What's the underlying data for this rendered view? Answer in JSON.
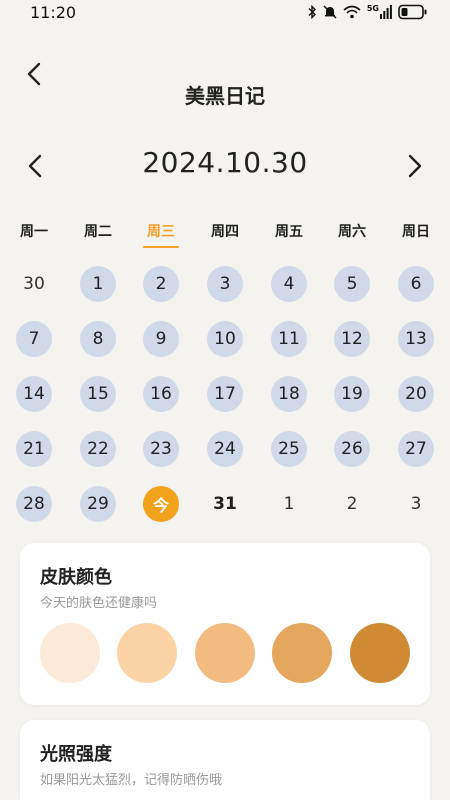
{
  "status_bar": {
    "time": "11:20",
    "icons": [
      "bluetooth-icon",
      "mute-bell-icon",
      "wifi-icon",
      "signal-5g-icon",
      "battery-icon"
    ],
    "network_label": "5G"
  },
  "header": {
    "back_icon": "chevron-left-icon",
    "title": "美黑日记"
  },
  "date_nav": {
    "prev_icon": "chevron-left-icon",
    "current_date": "2024.10.30",
    "next_icon": "chevron-right-icon"
  },
  "weekdays": [
    {
      "label": "周一",
      "active": false
    },
    {
      "label": "周二",
      "active": false
    },
    {
      "label": "周三",
      "active": true
    },
    {
      "label": "周四",
      "active": false
    },
    {
      "label": "周五",
      "active": false
    },
    {
      "label": "周六",
      "active": false
    },
    {
      "label": "周日",
      "active": false
    }
  ],
  "calendar": {
    "weeks": [
      [
        {
          "label": "30",
          "state": "plain"
        },
        {
          "label": "1",
          "state": "recorded"
        },
        {
          "label": "2",
          "state": "recorded"
        },
        {
          "label": "3",
          "state": "recorded"
        },
        {
          "label": "4",
          "state": "recorded"
        },
        {
          "label": "5",
          "state": "recorded"
        },
        {
          "label": "6",
          "state": "recorded"
        }
      ],
      [
        {
          "label": "7",
          "state": "recorded"
        },
        {
          "label": "8",
          "state": "recorded"
        },
        {
          "label": "9",
          "state": "recorded"
        },
        {
          "label": "10",
          "state": "recorded"
        },
        {
          "label": "11",
          "state": "recorded"
        },
        {
          "label": "12",
          "state": "recorded"
        },
        {
          "label": "13",
          "state": "recorded"
        }
      ],
      [
        {
          "label": "14",
          "state": "recorded"
        },
        {
          "label": "15",
          "state": "recorded"
        },
        {
          "label": "16",
          "state": "recorded"
        },
        {
          "label": "17",
          "state": "recorded"
        },
        {
          "label": "18",
          "state": "recorded"
        },
        {
          "label": "19",
          "state": "recorded"
        },
        {
          "label": "20",
          "state": "recorded"
        }
      ],
      [
        {
          "label": "21",
          "state": "recorded"
        },
        {
          "label": "22",
          "state": "recorded"
        },
        {
          "label": "23",
          "state": "recorded"
        },
        {
          "label": "24",
          "state": "recorded"
        },
        {
          "label": "25",
          "state": "recorded"
        },
        {
          "label": "26",
          "state": "recorded"
        },
        {
          "label": "27",
          "state": "recorded"
        }
      ],
      [
        {
          "label": "28",
          "state": "recorded"
        },
        {
          "label": "29",
          "state": "recorded"
        },
        {
          "label": "今",
          "state": "today"
        },
        {
          "label": "31",
          "state": "bold"
        },
        {
          "label": "1",
          "state": "plain"
        },
        {
          "label": "2",
          "state": "plain"
        },
        {
          "label": "3",
          "state": "plain"
        }
      ]
    ]
  },
  "skin_color_card": {
    "title": "皮肤颜色",
    "subtitle": "今天的肤色还健康吗",
    "swatches": [
      "#fde9d8",
      "#fbd3a5",
      "#f3bb80",
      "#e4a75d",
      "#cf8a33"
    ]
  },
  "light_card": {
    "title": "光照强度",
    "subtitle": "如果阳光太猛烈，记得防晒伤哦"
  },
  "colors": {
    "background": "#f4f3ef",
    "accent": "#f3a21c",
    "recorded_day": "#cfd9e8",
    "card": "#ffffff"
  }
}
